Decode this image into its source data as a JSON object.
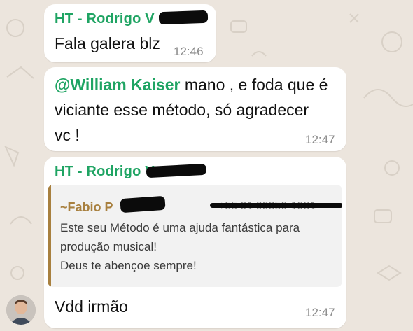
{
  "messages": [
    {
      "sender": "HT - Rodrigo V",
      "text": "Fala galera blz",
      "time": "12:46"
    },
    {
      "mention": "@William Kaiser",
      "line1_rest": " mano , e foda que é",
      "line2": "viciante esse método, só agradecer",
      "line3": "vc !",
      "time": "12:47"
    },
    {
      "sender": "HT - Rodrigo V",
      "quote": {
        "author": "~Fabio P",
        "phone": "+55 91 99350-1981",
        "lines": [
          "Este seu Método é uma ajuda fantástica para",
          "produção musical!",
          "Deus te abençoe sempre!"
        ]
      },
      "text": "Vdd irmão",
      "time": "12:47"
    }
  ],
  "colors": {
    "background": "#ece5dd",
    "sender": "#1fa463",
    "quote_accent": "#a8803f"
  },
  "icons": [
    "avatar",
    "wallpaper-doodles"
  ]
}
